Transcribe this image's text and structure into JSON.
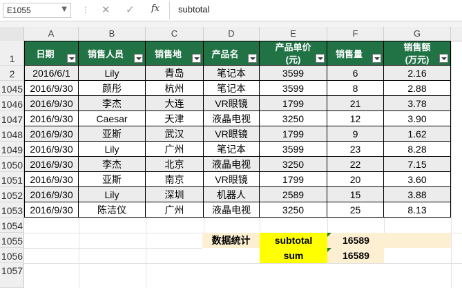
{
  "formula_bar": {
    "name_box": "E1055",
    "formula": "subtotal",
    "fx_label": "fx",
    "cancel_glyph": "✕",
    "enter_glyph": "✓"
  },
  "columns": [
    "A",
    "B",
    "C",
    "D",
    "E",
    "F",
    "G"
  ],
  "rows": {
    "header": "1",
    "data": [
      "2",
      "1045",
      "1046",
      "1047",
      "1048",
      "1049",
      "1050",
      "1051",
      "1052",
      "1053"
    ],
    "extra": [
      "1054",
      "1055",
      "1056",
      "1057"
    ]
  },
  "table": {
    "headers": [
      "日期",
      "销售人员",
      "销售地",
      "产品名",
      "产品单价",
      "销售量",
      "销售额"
    ],
    "header_second_line": {
      "unit_price": "(元)",
      "amount": "(万元)"
    },
    "records": [
      [
        "2016/6/1",
        "Lily",
        "青岛",
        "笔记本",
        "3599",
        "6",
        "2.16"
      ],
      [
        "2016/9/30",
        "颜彤",
        "杭州",
        "笔记本",
        "3599",
        "8",
        "2.88"
      ],
      [
        "2016/9/30",
        "李杰",
        "大连",
        "VR眼镜",
        "1799",
        "21",
        "3.78"
      ],
      [
        "2016/9/30",
        "Caesar",
        "天津",
        "液晶电视",
        "3250",
        "12",
        "3.90"
      ],
      [
        "2016/9/30",
        "亚斯",
        "武汉",
        "VR眼镜",
        "1799",
        "9",
        "1.62"
      ],
      [
        "2016/9/30",
        "Lily",
        "广州",
        "笔记本",
        "3599",
        "23",
        "8.28"
      ],
      [
        "2016/9/30",
        "李杰",
        "北京",
        "液晶电视",
        "3250",
        "22",
        "7.15"
      ],
      [
        "2016/9/30",
        "亚斯",
        "南京",
        "VR眼镜",
        "1799",
        "20",
        "3.60"
      ],
      [
        "2016/9/30",
        "Lily",
        "深圳",
        "机器人",
        "2589",
        "15",
        "3.88"
      ],
      [
        "2016/9/30",
        "陈洁仪",
        "广州",
        "液晶电视",
        "3250",
        "25",
        "8.13"
      ]
    ]
  },
  "summary": {
    "label": "数据统计",
    "subtotal_label": "subtotal",
    "subtotal_value": "16589",
    "sum_label": "sum",
    "sum_value": "16589"
  },
  "colors": {
    "header_green": "#217346",
    "zebra": "#ececec",
    "summary_tan": "#fdefd2",
    "summary_yellow": "#ffff00"
  }
}
